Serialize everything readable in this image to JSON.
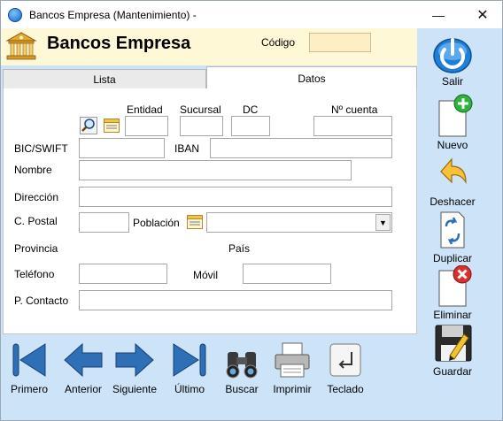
{
  "window": {
    "title": "Bancos Empresa (Mantenimiento) -",
    "min_glyph": "—",
    "max_glyph": "☐",
    "close_glyph": "✕"
  },
  "header": {
    "title": "Bancos Empresa",
    "codigo_label": "Código",
    "codigo_value": ""
  },
  "tabs": [
    {
      "label": "Lista",
      "active": false
    },
    {
      "label": "Datos",
      "active": true
    }
  ],
  "form": {
    "entidad_label": "Entidad",
    "sucursal_label": "Sucursal",
    "dc_label": "DC",
    "cuenta_label": "Nº cuenta",
    "bic_label": "BIC/SWIFT",
    "iban_label": "IBAN",
    "nombre_label": "Nombre",
    "direccion_label": "Dirección",
    "cpostal_label": "C. Postal",
    "poblacion_label": "Población",
    "provincia_label": "Provincia",
    "pais_label": "País",
    "telefono_label": "Teléfono",
    "movil_label": "Móvil",
    "contacto_label": "P. Contacto",
    "entidad": "",
    "sucursal": "",
    "dc": "",
    "cuenta": "",
    "bic": "",
    "iban": "",
    "nombre": "",
    "direccion": "",
    "cpostal": "",
    "poblacion": "",
    "telefono": "",
    "movil": "",
    "contacto": ""
  },
  "sidebar": {
    "salir": "Salir",
    "nuevo": "Nuevo",
    "deshacer": "Deshacer",
    "duplicar": "Duplicar",
    "eliminar": "Eliminar",
    "guardar": "Guardar"
  },
  "bottom": {
    "primero": "Primero",
    "anterior": "Anterior",
    "siguiente": "Siguiente",
    "ultimo": "Último",
    "buscar": "Buscar",
    "imprimir": "Imprimir",
    "teclado": "Teclado"
  },
  "colors": {
    "window_bg": "#cde3f8",
    "header_bg": "#fff8d6",
    "codigo_bg": "#fdeec6",
    "nav_blue": "#2f6fb6"
  }
}
